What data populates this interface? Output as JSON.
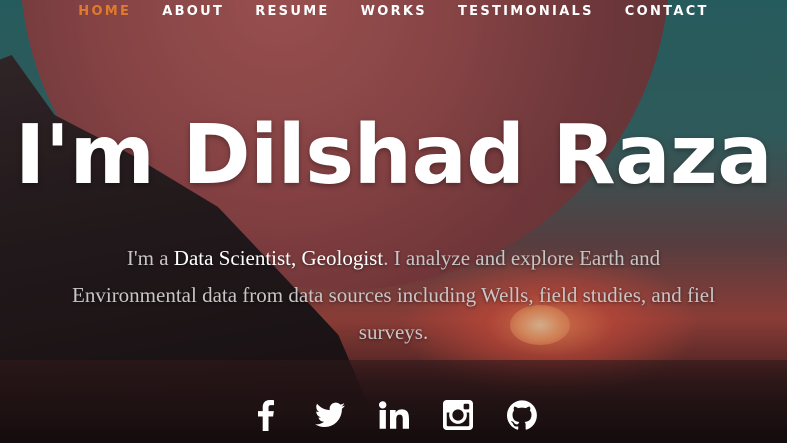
{
  "nav": {
    "items": [
      {
        "label": "HOME",
        "active": true
      },
      {
        "label": "ABOUT"
      },
      {
        "label": "RESUME"
      },
      {
        "label": "WORKS"
      },
      {
        "label": "TESTIMONIALS"
      },
      {
        "label": "CONTACT"
      }
    ],
    "active_color": "#e07a2e"
  },
  "hero": {
    "headline": "I'm Dilshad Raza",
    "intro_prefix": "I'm a ",
    "intro_role": "Data Scientist, Geologist",
    "intro_line1_rest": ". I analyze and explore Earth and",
    "intro_line2": "Environmental data from data sources including Wells, field studies, and fiel",
    "intro_line3": "surveys."
  },
  "social": {
    "icons": [
      "facebook-icon",
      "twitter-icon",
      "linkedin-icon",
      "instagram-icon",
      "github-icon"
    ]
  }
}
